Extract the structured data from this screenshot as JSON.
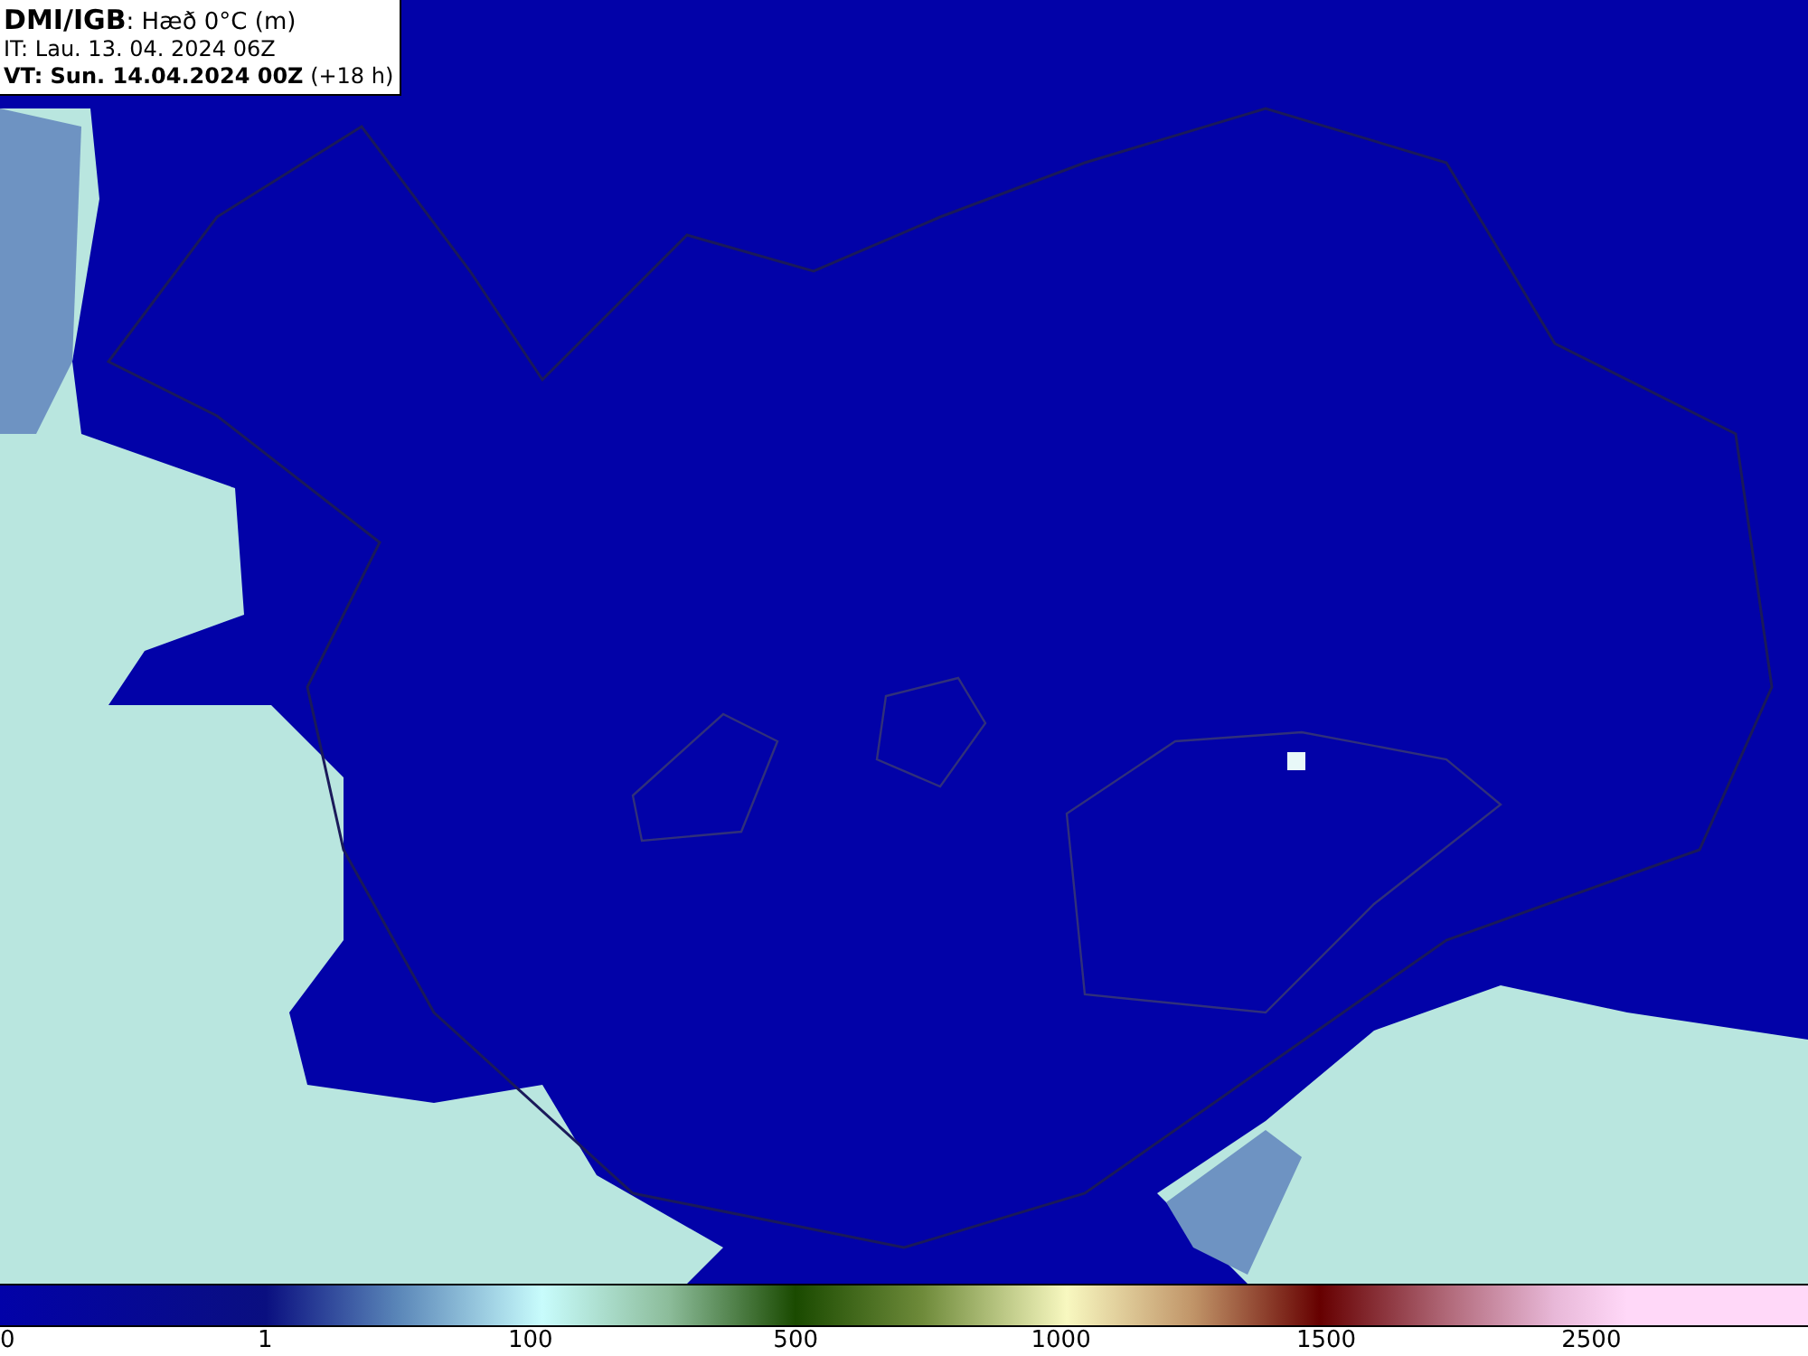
{
  "info_box": {
    "lines": [
      "**DMI/IGB**: Hæð 0°C (m)",
      "IT: Lau. 13. 04. 2024 06Z",
      "**VT: Sun. 14.04.2024 00Z** (+18 h)"
    ]
  },
  "legend": {
    "ticks": [
      "0",
      "1",
      "100",
      "500",
      "1000",
      "1500",
      "2500"
    ]
  }
}
